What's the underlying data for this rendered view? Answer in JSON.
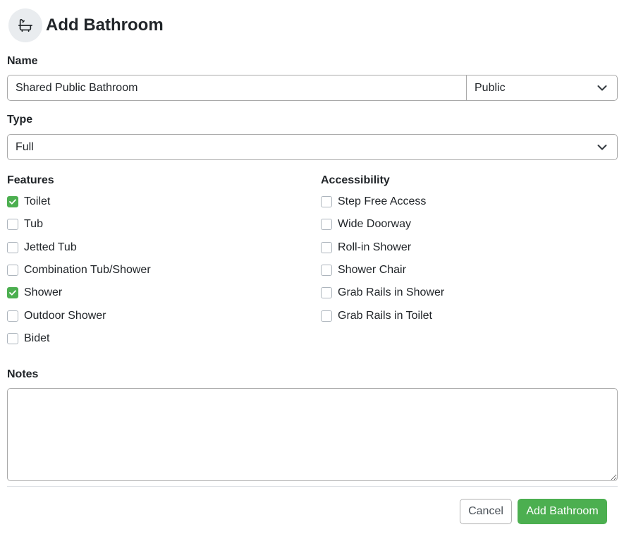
{
  "header": {
    "title": "Add Bathroom",
    "icon": "bathtub-icon"
  },
  "name_field": {
    "label": "Name",
    "value": "Shared Public Bathroom",
    "visibility_value": "Public"
  },
  "type_field": {
    "label": "Type",
    "value": "Full"
  },
  "features": {
    "title": "Features",
    "items": [
      {
        "label": "Toilet",
        "checked": true
      },
      {
        "label": "Tub",
        "checked": false
      },
      {
        "label": "Jetted Tub",
        "checked": false
      },
      {
        "label": "Combination Tub/Shower",
        "checked": false
      },
      {
        "label": "Shower",
        "checked": true
      },
      {
        "label": "Outdoor Shower",
        "checked": false
      },
      {
        "label": "Bidet",
        "checked": false
      }
    ]
  },
  "accessibility": {
    "title": "Accessibility",
    "items": [
      {
        "label": "Step Free Access",
        "checked": false
      },
      {
        "label": "Wide Doorway",
        "checked": false
      },
      {
        "label": "Roll-in Shower",
        "checked": false
      },
      {
        "label": "Shower Chair",
        "checked": false
      },
      {
        "label": "Grab Rails in Shower",
        "checked": false
      },
      {
        "label": "Grab Rails in Toilet",
        "checked": false
      }
    ]
  },
  "notes": {
    "label": "Notes",
    "value": ""
  },
  "actions": {
    "cancel_label": "Cancel",
    "submit_label": "Add Bathroom"
  },
  "colors": {
    "accent": "#4caf50",
    "border": "#a9a9a9",
    "text": "#212529"
  }
}
